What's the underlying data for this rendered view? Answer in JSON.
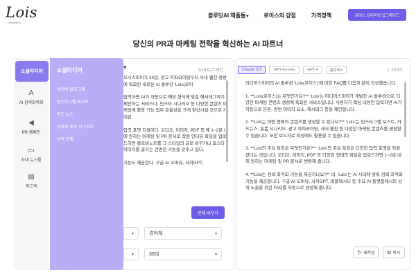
{
  "logo": {
    "word": "Lois",
    "sub": "Obsedia AI"
  },
  "nav": {
    "items": [
      {
        "label": "블루닷AI 제품들",
        "chev": "▾"
      },
      {
        "label": "로이스의 강점"
      },
      {
        "label": "가격정책"
      }
    ],
    "upgrade": "로이스 프리미엄 업그레이드"
  },
  "hero": {
    "title": "당신의 PR과 마케팅 전략을 혁신하는 AI 파트너"
  },
  "sidebar": {
    "items": [
      {
        "label": "소셜미디어",
        "icon": "share-icon",
        "glyph": "⋖"
      },
      {
        "label": "AI 검색최적화",
        "icon": "ai-icon",
        "glyph": "A"
      },
      {
        "label": "PR 캠페인",
        "icon": "megaphone-icon",
        "glyph": "◀"
      },
      {
        "label": "사내 뉴스룸",
        "icon": "tv-icon",
        "glyph": "▭"
      },
      {
        "label": "피드백",
        "icon": "feedback-icon",
        "glyph": "▤"
      }
    ]
  },
  "flyout": {
    "title": "소셜미디어",
    "items": [
      "네이버 블로그체",
      "인스타그램 포스트",
      "카드 뉴스",
      "유튜브 숏츠 시나리오",
      "사적 문체"
    ]
  },
  "left": {
    "count": "939자/무제한",
    "paragraphs": [
      "오시스피어가 24일, 광고 카피라이팅부터 사내 웹진 생성에 특화된 새로운 AI 솔루션 'Lois(로이",
      "입력하면 AI가 자동으로 해당 형식에 맞춘 해서태그까지 제안하는 서비스다. 인스타 시나리오 등 다양한 콘텐츠 마케팅에 활용 가능 업무 효율성을 크게 향상시킬 것으로 기대된",
      "입력 포맷 지원이다. 오디오, 이미지, PDF 등 에 1~2분 내에 원하는 마케팅 및 PR 문서로 작원 인터뷰 파일을 업로드하면 클로바노트를 그 스타일의 글로 바꾸거나 포스터 이미지를 출하는 간편한 기능을 갖추고 있다.",
      "기능도 제공한다. 구글 AI 오버뷰, 서치GPT,"
    ],
    "rewrite_button": "문체 바꾸기",
    "select_a": "",
    "select_b": "경어체",
    "select_c": "",
    "select_d": "30대"
  },
  "right": {
    "tabs": [
      "Claude 3.5",
      "GPT-4o-mini",
      "GPT-4",
      "클로바X"
    ],
    "count": "1,333자",
    "paragraphs": [
      "미디어스피어의 AI 솔루션 'Lois(로이스)'에 대한 FAQ를 다음과 같이 작성했습니다.",
      "1. **Lois(로이스)는 무엇인가요?** 'Lois'는 미디어스피어가 개발한 AI 솔루션으로, 다양한 마케팅 콘텐츠 생성에 특화된 서비스입니다. 사용자가 핵심 내용만 입력하면 AI가 자동으로 본문, 관련 이미지 요소, 해시태그 등을 제안합니다.",
      "2. **Lois는 어떤 종류의 콘텐츠를 생성할 수 있나요?** 'Lois'는 인스타그램 포스트, 카드뉴스, 숏폼 시나리오, 광고 카피라이팅, 사내 웹진 등 다양한 마케팅 콘텐츠를 생성할 수 있습니다. 또한 보도자료 작성에도 활용할 수 있습니다.",
      "3. **Lois의 주요 특징은 무엇인가요?** 'Lois'의 주요 특징은 다양한 입력 포맷을 지원한다는 것입니다. 오디오, 이미지, PDF 등 다양한 형태의 파일을 업로드하면 1~2분 내에 원하는 마케팅 및 PR 문서로 변환해 줍니다.",
      "4. **Lois는 검색 최적화 기능을 제공하나요?** 네, 'Lois'는 AI 시대에 맞춰 검색 최적화 기능을 제공합니다. 구글 AI 오버뷰, 서치GPT, 퍼플렉시티 등 주요 AI 플랫폼에서의 상위 노출을 위한 FAQ를 자동으로 생성해 줍니다."
    ],
    "regen_button": "재작성",
    "copy_button": "복사"
  }
}
